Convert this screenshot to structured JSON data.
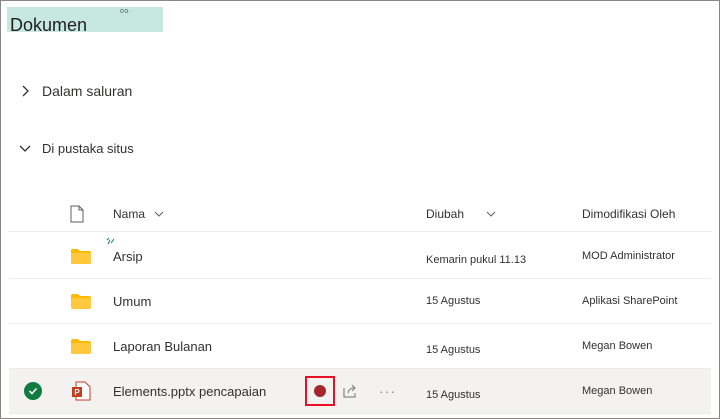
{
  "library": {
    "title": "Dokumen",
    "title_tag": "oo·"
  },
  "sections": [
    {
      "label": "Dalam saluran",
      "expanded": false
    },
    {
      "label": "Di pustaka situs",
      "expanded": true
    }
  ],
  "columns": {
    "name": "Nama",
    "modified": "Diubah",
    "modified_by": "Dimodifikasi Oleh"
  },
  "rows": [
    {
      "type": "folder",
      "name": "Arsip",
      "modified": "Kemarin pukul 11.13",
      "modified_by": "MOD Administrator",
      "is_new": true
    },
    {
      "type": "folder",
      "name": "Umum",
      "modified": "15 Agustus",
      "modified_by": "Aplikasi SharePoint"
    },
    {
      "type": "folder",
      "name": "Laporan Bulanan",
      "modified": "15 Agustus",
      "modified_by": "Megan Bowen"
    },
    {
      "type": "pptx",
      "name": "Elements.pptx pencapaian",
      "modified": "15 Agustus",
      "modified_by": "Megan Bowen",
      "selected": true
    }
  ],
  "colors": {
    "folder": "#ffb900",
    "ppt": "#c43e1c",
    "check": "#107c41",
    "title_highlight": "#c7e8df",
    "pin_border": "#e81123"
  },
  "icons": {
    "more": "···"
  }
}
